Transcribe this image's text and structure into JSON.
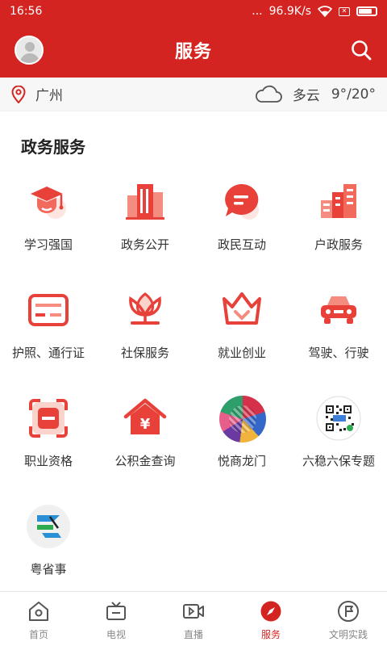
{
  "status_bar": {
    "time": "16:56",
    "dots": "...",
    "network_speed": "96.9K/s"
  },
  "header": {
    "title": "服务"
  },
  "weather": {
    "city": "广州",
    "condition": "多云",
    "temperature": "9°/20°"
  },
  "section": {
    "title": "政务服务"
  },
  "services": [
    {
      "label": "学习强国",
      "icon": "graduation-cap-icon"
    },
    {
      "label": "政务公开",
      "icon": "building-icon"
    },
    {
      "label": "政民互动",
      "icon": "chat-bubble-icon"
    },
    {
      "label": "户政服务",
      "icon": "buildings-icon"
    },
    {
      "label": "护照、通行证",
      "icon": "passport-card-icon"
    },
    {
      "label": "社保服务",
      "icon": "lotus-icon"
    },
    {
      "label": "就业创业",
      "icon": "crown-icon"
    },
    {
      "label": "驾驶、行驶",
      "icon": "car-icon"
    },
    {
      "label": "职业资格",
      "icon": "id-frame-icon"
    },
    {
      "label": "公积金查询",
      "icon": "house-yen-icon"
    },
    {
      "label": "悦商龙门",
      "icon": "mosaic-logo-icon"
    },
    {
      "label": "六稳六保专题",
      "icon": "qr-code-icon"
    },
    {
      "label": "粤省事",
      "icon": "yue-app-icon"
    }
  ],
  "tabs": [
    {
      "label": "首页",
      "icon": "home-icon"
    },
    {
      "label": "电视",
      "icon": "tv-icon"
    },
    {
      "label": "直播",
      "icon": "video-icon"
    },
    {
      "label": "服务",
      "icon": "compass-icon",
      "active": true
    },
    {
      "label": "文明实践",
      "icon": "flag-circle-icon"
    }
  ],
  "colors": {
    "brand": "#d42422",
    "icon_red": "#e8413a",
    "tab_inactive": "#888888"
  }
}
